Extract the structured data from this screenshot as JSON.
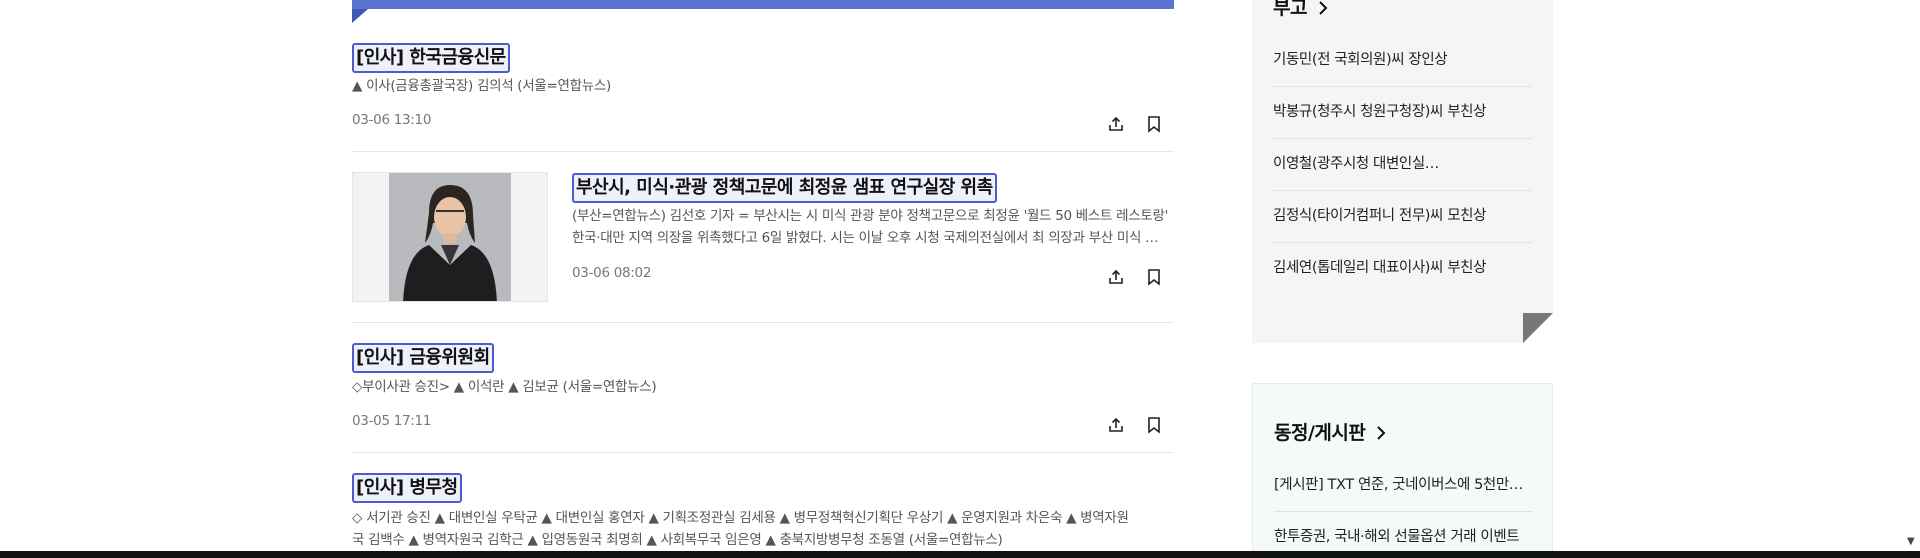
{
  "articles": [
    {
      "title": "[인사] 한국금융신문",
      "summary": "▲ 이사(금융총괄국장) 김의석 (서울=연합뉴스)",
      "date": "03-06 13:10"
    },
    {
      "title": "부산시, 미식·관광 정책고문에 최정윤 샘표 연구실장 위촉",
      "summary_line1": "(부산=연합뉴스) 김선호 기자 = 부산시는 시 미식 관광 분야 정책고문으로 최정윤 '월드 50 베스트 레스토랑'",
      "summary_line2": "한국·대만 지역 의장을 위촉했다고 6일 밝혔다. 시는 이날 오후 시청 국제의전실에서 최 의장과 부산 미식 …",
      "date": "03-06 08:02"
    },
    {
      "title": "[인사] 금융위원회",
      "summary": "◇부이사관 승진> ▲ 이석란 ▲ 김보균 (서울=연합뉴스)",
      "date": "03-05 17:11"
    },
    {
      "title": "[인사] 병무청",
      "summary_line1": "◇ 서기관 승진 ▲ 대변인실 우탁균 ▲ 대변인실 홍연자 ▲ 기획조정관실 김세용 ▲ 병무정책혁신기획단 우상기 ▲ 운영지원과 차은숙 ▲ 병역자원",
      "summary_line2": "국 김백수 ▲ 병역자원국 김학근 ▲ 입영동원국 최명희 ▲ 사회복무국 임은영 ▲ 충북지방병무청 조동열 (서울=연합뉴스)"
    }
  ],
  "sidebar": {
    "obituary": {
      "title": "부고",
      "items": [
        "기동민(전 국회의원)씨 장인상",
        "박봉규(청주시 청원구청장)씨 부친상",
        "이영철(광주시청 대변인실…",
        "김정식(타이거컴퍼니 전무)씨 모친상",
        "김세연(톱데일리 대표이사)씨 부친상"
      ]
    },
    "board": {
      "title": "동정/게시판",
      "items": [
        "[게시판] TXT 연준, 굿네이버스에 5천만…",
        "한투증권, 국내·해외 선물옵션 거래 이벤트"
      ]
    }
  },
  "icons": {
    "share": "share-icon",
    "bookmark": "bookmark-icon",
    "chevron": "chevron-right-icon"
  },
  "colors": {
    "accent": "#5b74d0",
    "title_outline": "#4a5bd4"
  }
}
